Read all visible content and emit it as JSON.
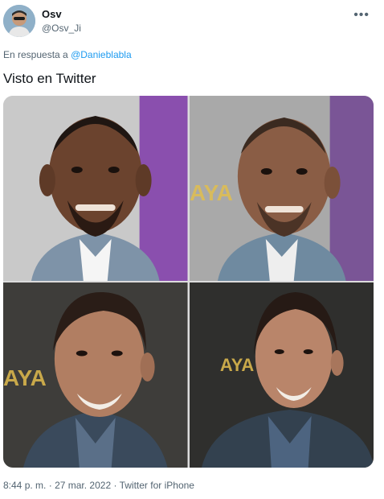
{
  "author": {
    "name": "Osv",
    "handle": "@Osv_Ji",
    "more_icon": "more-horizontal-icon"
  },
  "reply": {
    "prefix": "En respuesta a",
    "mention": "@Danieblabla"
  },
  "tweet": {
    "text": "Visto en Twitter"
  },
  "media": {
    "cells": [
      {
        "backdrop_text": ""
      },
      {
        "backdrop_text": "AYA"
      },
      {
        "backdrop_text": "AYA"
      },
      {
        "backdrop_text": "AYA"
      }
    ]
  },
  "meta": {
    "time": "8:44 p. m.",
    "separator": "·",
    "date": "27 mar. 2022",
    "source": "Twitter for iPhone"
  }
}
